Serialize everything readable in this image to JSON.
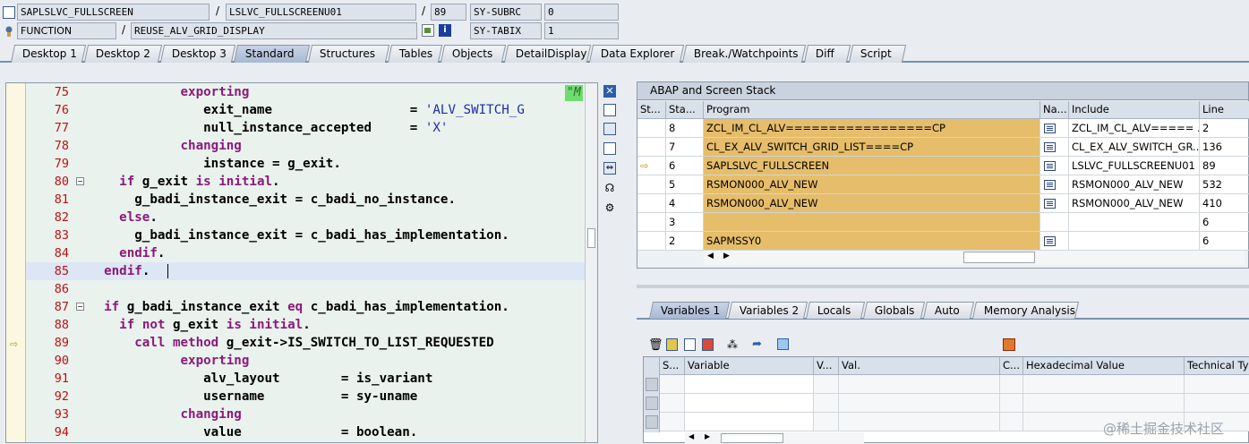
{
  "header": {
    "row1": {
      "program": "SAPLSLVC_FULLSCREEN",
      "include": "LSLVC_FULLSCREENU01",
      "line": "89",
      "sysvar_name": "SY-SUBRC",
      "sysvar_value": "0"
    },
    "row2": {
      "event_type": "FUNCTION",
      "event_name": "REUSE_ALV_GRID_DISPLAY",
      "sysvar_name": "SY-TABIX",
      "sysvar_value": "1"
    },
    "separator": "/"
  },
  "tabs": [
    "Desktop 1",
    "Desktop 2",
    "Desktop 3",
    "Standard",
    "Structures",
    "Tables",
    "Objects",
    "DetailDisplay",
    "Data Explorer",
    "Break./Watchpoints",
    "Diff",
    "Script"
  ],
  "active_tab": "Standard",
  "editor": {
    "comment_fragment": "\"M",
    "lines": [
      {
        "n": "75",
        "t": "            exporting"
      },
      {
        "n": "76",
        "t": "               exit_name                  = 'ALV_SWITCH_G"
      },
      {
        "n": "77",
        "t": "               null_instance_accepted     = 'X'"
      },
      {
        "n": "78",
        "t": "            changing"
      },
      {
        "n": "79",
        "t": "               instance = g_exit."
      },
      {
        "n": "80",
        "t": "    if g_exit is initial."
      },
      {
        "n": "81",
        "t": "      g_badi_instance_exit = c_badi_no_instance."
      },
      {
        "n": "82",
        "t": "    else."
      },
      {
        "n": "83",
        "t": "      g_badi_instance_exit = c_badi_has_implementation."
      },
      {
        "n": "84",
        "t": "    endif."
      },
      {
        "n": "85",
        "t": "  endif."
      },
      {
        "n": "86",
        "t": ""
      },
      {
        "n": "87",
        "t": "  if g_badi_instance_exit eq c_badi_has_implementation."
      },
      {
        "n": "88",
        "t": "    if not g_exit is initial."
      },
      {
        "n": "89",
        "t": "      call method g_exit->IS_SWITCH_TO_LIST_REQUESTED"
      },
      {
        "n": "90",
        "t": "            exporting"
      },
      {
        "n": "91",
        "t": "               alv_layout        = is_variant"
      },
      {
        "n": "92",
        "t": "               username          = sy-uname"
      },
      {
        "n": "93",
        "t": "            changing"
      },
      {
        "n": "94",
        "t": "               value             = boolean."
      }
    ]
  },
  "stack": {
    "title": "ABAP and Screen Stack",
    "columns": [
      "St...",
      "Sta...",
      "Program",
      "Na...",
      "Include",
      "Line"
    ],
    "rows": [
      {
        "level": "8",
        "program": "ZCL_IM_CL_ALV=================CP",
        "include": "ZCL_IM_CL_ALV===== ...",
        "line": "2",
        "current": false
      },
      {
        "level": "7",
        "program": "CL_EX_ALV_SWITCH_GRID_LIST====CP",
        "include": "CL_EX_ALV_SWITCH_GR...",
        "line": "136",
        "current": false
      },
      {
        "level": "6",
        "program": "SAPLSLVC_FULLSCREEN",
        "include": "LSLVC_FULLSCREENU01",
        "line": "89",
        "current": true
      },
      {
        "level": "5",
        "program": "RSMON000_ALV_NEW",
        "include": "RSMON000_ALV_NEW",
        "line": "532",
        "current": false
      },
      {
        "level": "4",
        "program": "RSMON000_ALV_NEW",
        "include": "RSMON000_ALV_NEW",
        "line": "410",
        "current": false
      },
      {
        "level": "3",
        "program": "",
        "include": "",
        "line": "6",
        "current": false
      },
      {
        "level": "2",
        "program": "SAPMSSY0",
        "include": "",
        "line": "6",
        "current": false
      }
    ]
  },
  "var_tabs": [
    "Variables 1",
    "Variables 2",
    "Locals",
    "Globals",
    "Auto",
    "Memory Analysis"
  ],
  "active_var_tab": "Variables 1",
  "variables": {
    "columns": [
      "S...",
      "Variable",
      "V...",
      "Val.",
      "C...",
      "Hexadecimal Value",
      "Technical Typ"
    ]
  },
  "watermark": "@稀土掘金技术社区",
  "colors": {
    "stack_highlight": "#e6bd6a",
    "keyword": "#8b1a7a",
    "string": "#1b2ea8",
    "line_number": "#c01010"
  }
}
